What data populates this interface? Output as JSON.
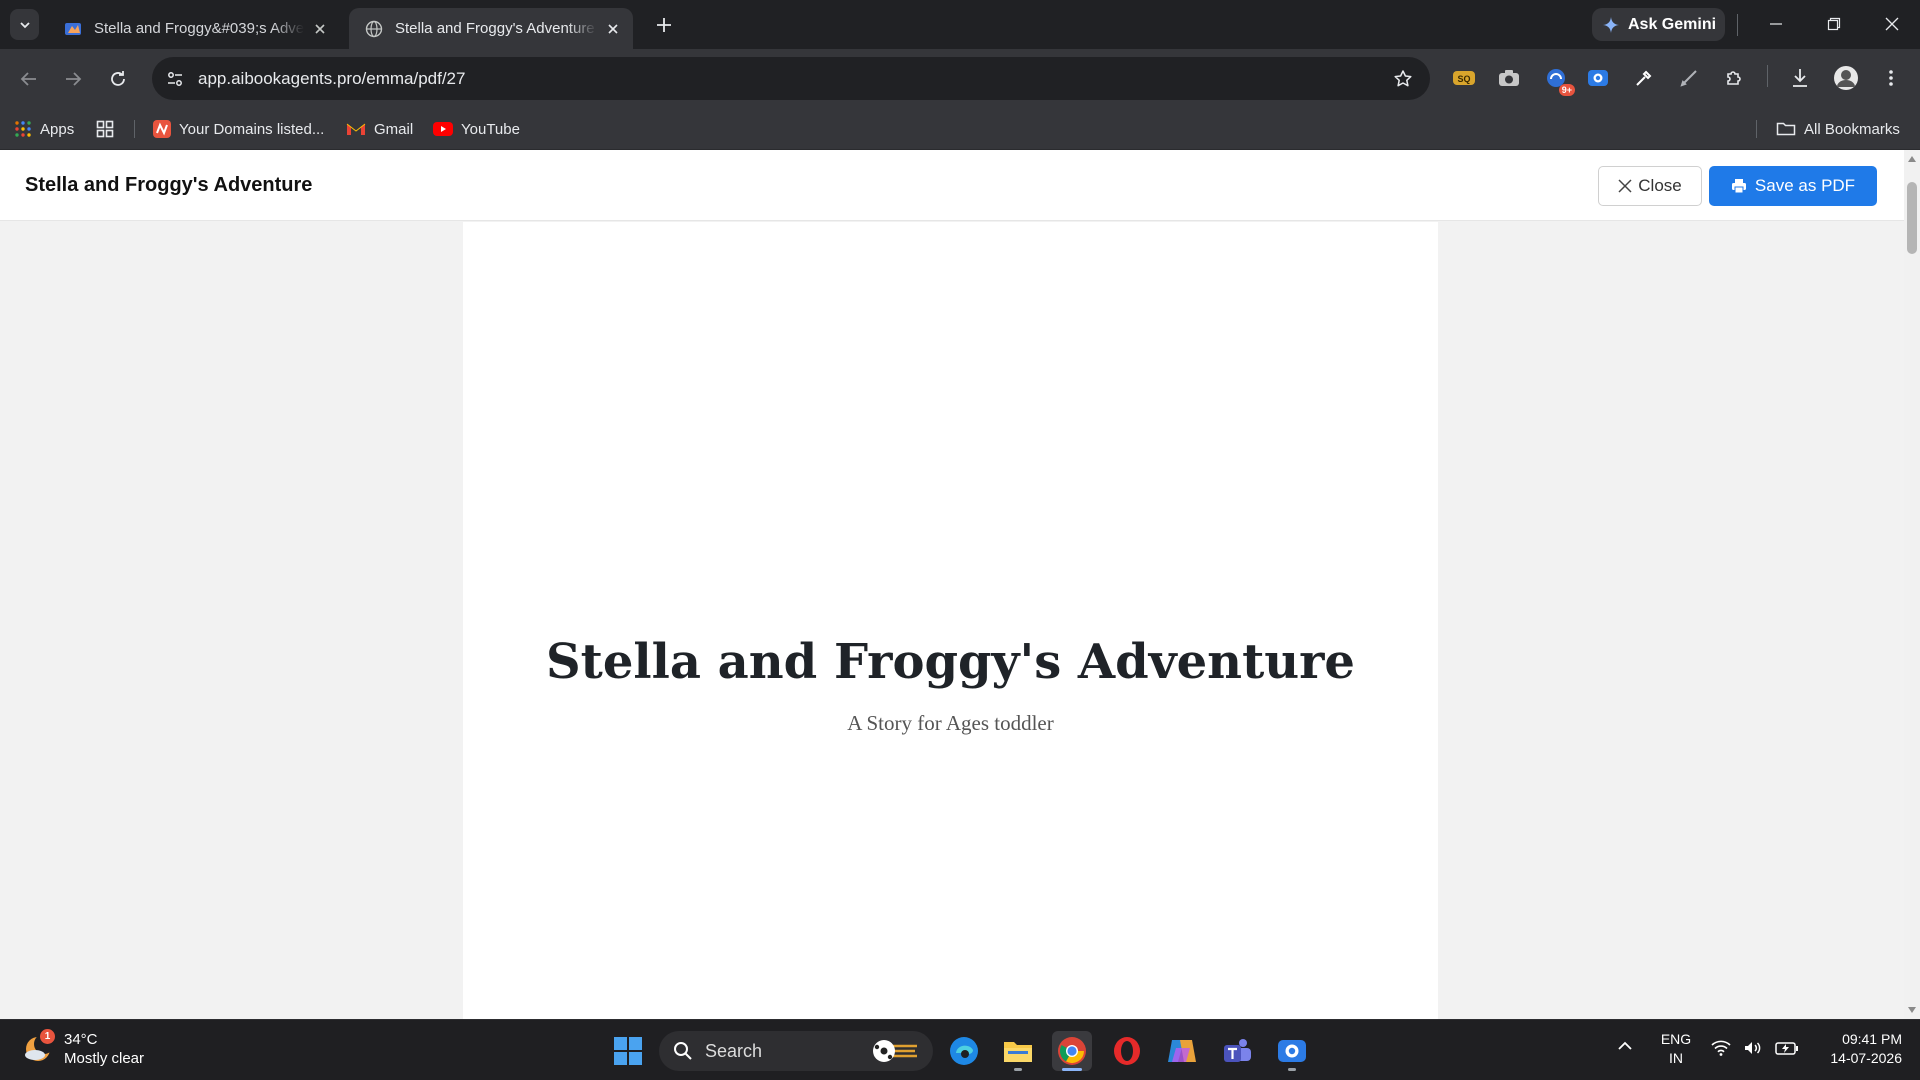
{
  "browser": {
    "tabs": [
      {
        "title": "Stella and Froggy&#039;s Adve",
        "active": false
      },
      {
        "title": "Stella and Froggy's Adventure - ",
        "active": true
      }
    ],
    "ask_gemini": "Ask Gemini",
    "url": "app.aibookagents.pro/emma/pdf/27",
    "extension_badge": "9+",
    "bookmarks": [
      {
        "label": "Apps",
        "icon": "apps-grid-icon"
      },
      {
        "label": "Your Domains listed...",
        "icon": "namecheap-icon"
      },
      {
        "label": "Gmail",
        "icon": "gmail-icon"
      },
      {
        "label": "YouTube",
        "icon": "youtube-icon"
      }
    ],
    "all_bookmarks": "All Bookmarks"
  },
  "viewer": {
    "title": "Stella and Froggy's Adventure",
    "close_label": "Close",
    "save_label": "Save as PDF",
    "accent": "#1f7ae8"
  },
  "book": {
    "title": "Stella and Froggy's Adventure",
    "subtitle": "A Story for Ages toddler"
  },
  "taskbar": {
    "weather_temp": "34°C",
    "weather_desc": "Mostly clear",
    "weather_badge": "1",
    "search_label": "Search",
    "lang_primary": "ENG",
    "lang_secondary": "IN",
    "time": "09:41 PM",
    "date": "14-07-2026"
  }
}
